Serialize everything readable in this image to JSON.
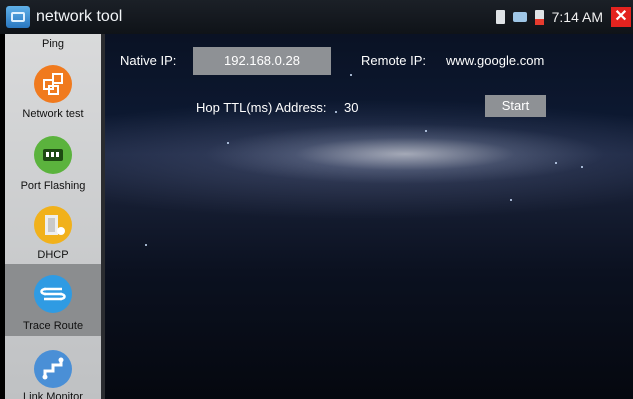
{
  "app": {
    "title": "network tool"
  },
  "status": {
    "time": "7:14 AM",
    "close_glyph": "✕"
  },
  "sidebar": {
    "items": [
      {
        "label": "Ping",
        "icon": "ping-icon",
        "color": ""
      },
      {
        "label": "Network test",
        "icon": "network-test-icon",
        "color": "#f07a1e"
      },
      {
        "label": "Port Flashing",
        "icon": "port-flashing-icon",
        "color": "#5bb33d"
      },
      {
        "label": "DHCP",
        "icon": "dhcp-icon",
        "color": "#f1b11b"
      },
      {
        "label": "Trace Route",
        "icon": "trace-route-icon",
        "color": "#2f9be3",
        "active": true
      },
      {
        "label": "Link Monitor",
        "icon": "link-monitor-icon",
        "color": "#4a8fd6"
      }
    ]
  },
  "form": {
    "native_ip_label": "Native IP:",
    "native_ip_value": "192.168.0.28",
    "remote_ip_label": "Remote IP:",
    "remote_ip_value": "www.google.com",
    "hop_label": "Hop TTL(ms) Address:",
    "hop_value": "30",
    "start_label": "Start"
  }
}
